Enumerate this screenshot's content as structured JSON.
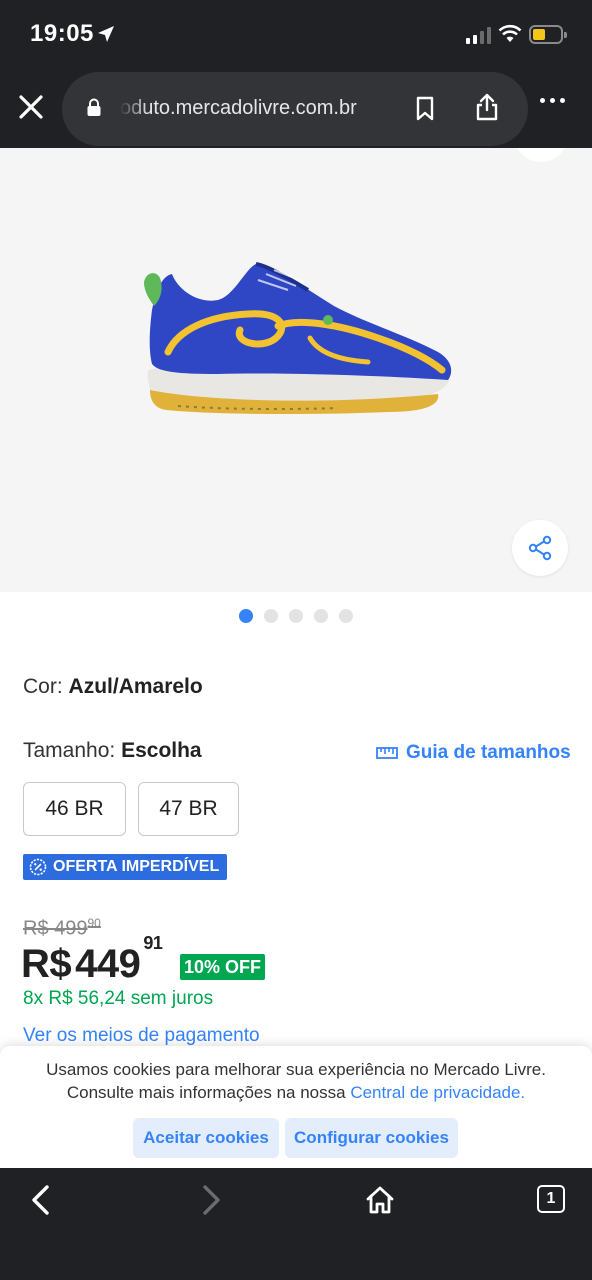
{
  "status_bar": {
    "time": "19:05"
  },
  "browser": {
    "url": "oduto.mercadolivre.com.br",
    "tab_count": "1"
  },
  "product": {
    "color_label": "Cor:",
    "color_value": "Azul/Amarelo",
    "size_label": "Tamanho:",
    "size_value": "Escolha",
    "size_guide": "Guia de tamanhos",
    "sizes": [
      "46 BR",
      "47 BR"
    ],
    "deal_badge": "OFERTA IMPERDÍVEL",
    "old_price_int": "R$ 499",
    "old_price_cents": "90",
    "price_currency": "R$",
    "price_int": "449",
    "price_cents": "91",
    "discount": "10% OFF",
    "installments": "8x R$ 56,24 sem juros",
    "payments_link": "Ver os meios de pagamento"
  },
  "gallery": {
    "image_count": 5,
    "active_index": 0
  },
  "cookie_banner": {
    "line1": "Usamos cookies para melhorar sua experiência no Mercado Livre.",
    "line2": "Consulte mais informações na nossa",
    "privacy_link": "Central de privacidade.",
    "accept": "Aceitar cookies",
    "configure": "Configurar cookies"
  },
  "colors": {
    "accent": "#3483fa",
    "green": "#00a650",
    "deal": "#2d6cdf",
    "chrome": "#202124"
  }
}
